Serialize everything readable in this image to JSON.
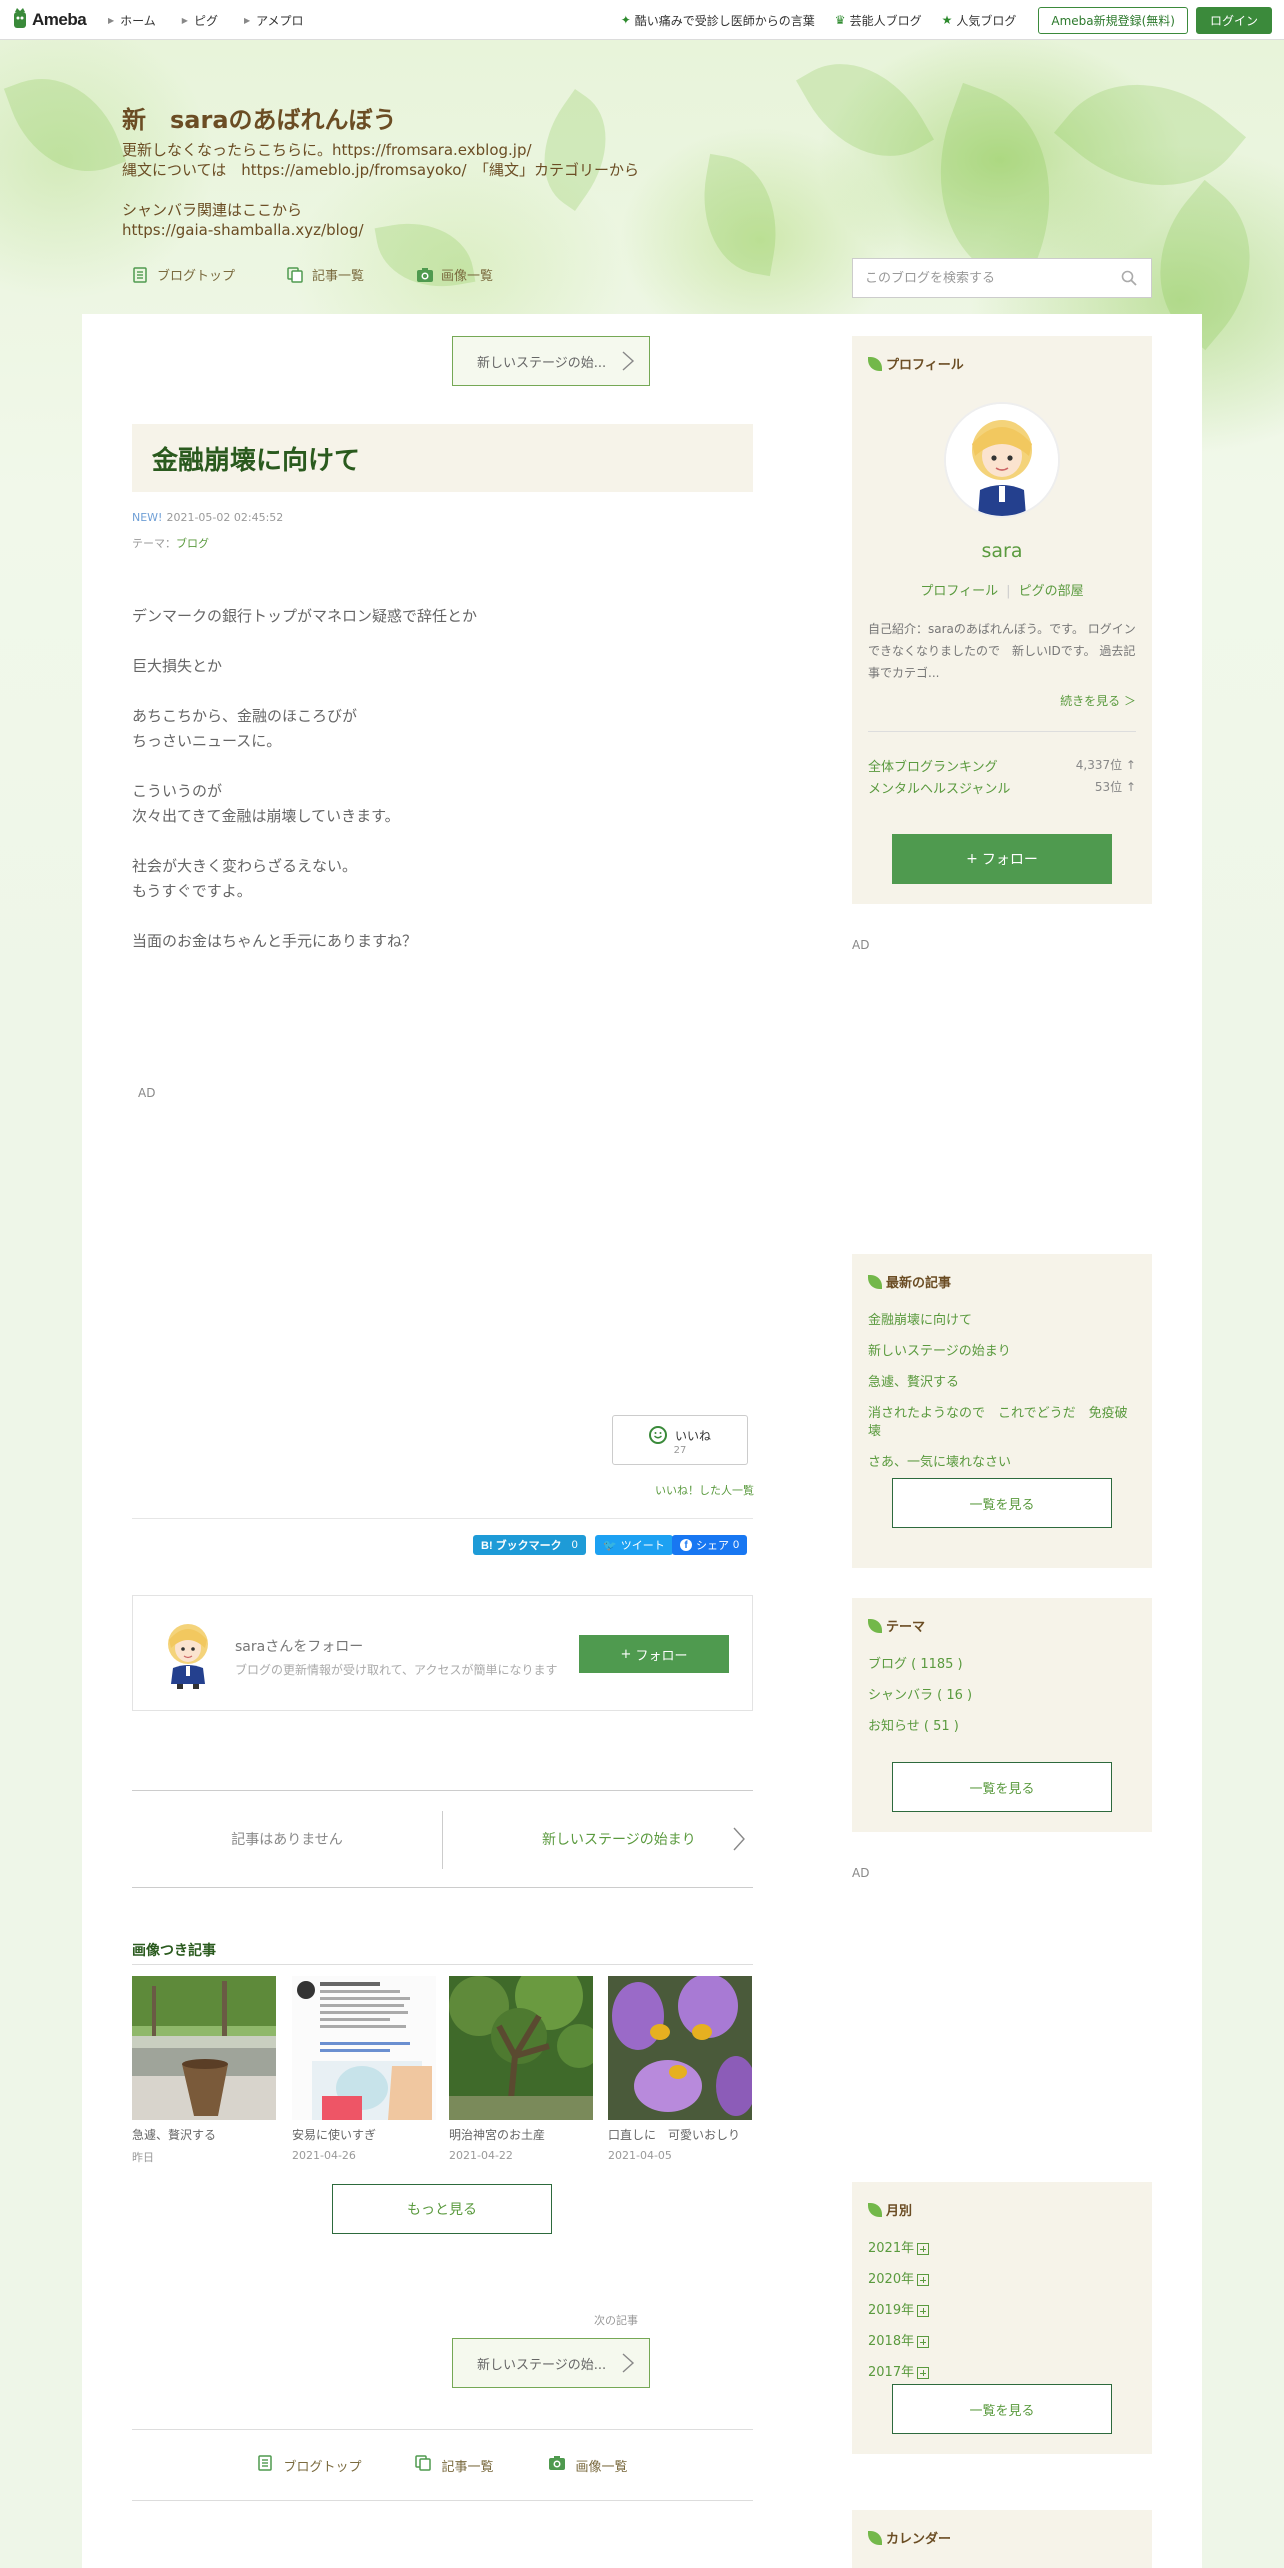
{
  "global_header": {
    "logo_text": "Ameba",
    "nav_left": [
      "ホーム",
      "ピグ",
      "アメプロ"
    ],
    "nav_right": [
      {
        "label": "酷い痛みで受診し医師からの言葉",
        "icon": "sparkle-icon"
      },
      {
        "label": "芸能人ブログ",
        "icon": "crown-icon"
      },
      {
        "label": "人気ブログ",
        "icon": "star-icon"
      }
    ],
    "register_label": "Ameba新規登録(無料)",
    "login_label": "ログイン"
  },
  "blog": {
    "title": "新　saraのあばれんぼう",
    "description": "更新しなくなったらこちらに。https://fromsara.exblog.jp/\n縄文については　https://ameblo.jp/fromsayoko/　「縄文」カテゴリーから\n\nシャンバラ関連はここから\nhttps://gaia-shamballa.xyz/blog/",
    "nav": {
      "top": "ブログトップ",
      "list": "記事一覧",
      "images": "画像一覧"
    },
    "search_placeholder": "このブログを検索する"
  },
  "article": {
    "prev_stage_label": "新しいステージの始...",
    "title": "金融崩壊に向けて",
    "new_badge": "NEW!",
    "datetime": "2021-05-02 02:45:52",
    "theme_prefix": "テーマ：",
    "theme": "ブログ",
    "paragraphs": [
      "デンマークの銀行トップがマネロン疑惑で辞任とか",
      "巨大損失とか",
      "あちこちから、金融のほころびが\nちっさいニュースに。",
      "こういうのが\n次々出てきて金融は崩壊していきます。",
      "社会が大きく変わらざるえない。\nもうすぐですよ。",
      "当面のお金はちゃんと手元にありますね？"
    ],
    "ad_label": "AD",
    "iine_label": "いいね",
    "iine_count": "27",
    "iine_list_label": "いいね！した人一覧",
    "share": {
      "hatena": {
        "label": "B! ブックマーク",
        "count": "0"
      },
      "tweet": {
        "label": "ツイート"
      },
      "facebook": {
        "label": "シェア",
        "count": "0"
      }
    },
    "follow_card": {
      "name": "saraさんをフォロー",
      "sub": "ブログの更新情報が受け取れて、アクセスが簡単になります",
      "button": "フォロー"
    },
    "pager": {
      "prev": "記事はありません",
      "next": "新しいステージの始まり"
    },
    "image_articles": {
      "title": "画像つき記事",
      "items": [
        {
          "caption": "急遽、贅沢する",
          "date": "昨日"
        },
        {
          "caption": "安易に使いすぎ",
          "date": "2021-04-26"
        },
        {
          "caption": "明治神宮のお土産",
          "date": "2021-04-22"
        },
        {
          "caption": "口直しに　可愛いおしり",
          "date": "2021-04-05"
        }
      ],
      "more_label": "もっと見る"
    },
    "next_article_label": "次の記事",
    "next_stage_label": "新しいステージの始..."
  },
  "sidebar": {
    "profile": {
      "heading": "プロフィール",
      "name": "sara",
      "link_profile": "プロフィール",
      "link_room": "ピグの部屋",
      "description": "自己紹介：saraのあばれんぼう。です。 ログインできなくなりましたので　新しいIDです。 過去記事でカテゴ...",
      "more": "続きを見る ＞",
      "ranking": [
        {
          "label": "全体ブログランキング",
          "value": "4,337位 ↑"
        },
        {
          "label": "メンタルヘルスジャンル",
          "value": "53位 ↑"
        }
      ],
      "follow": "フォロー"
    },
    "ad_label": "AD",
    "recent": {
      "heading": "最新の記事",
      "items": [
        "金融崩壊に向けて",
        "新しいステージの始まり",
        "急遽、贅沢する",
        "消されたようなので　これでどうだ　免疫破壊",
        "さあ、一気に壊れなさい"
      ],
      "button": "一覧を見る"
    },
    "themes": {
      "heading": "テーマ",
      "items": [
        "ブログ ( 1185 )",
        "シャンバラ ( 16 )",
        "お知らせ ( 51 )"
      ],
      "button": "一覧を見る"
    },
    "monthly": {
      "heading": "月別",
      "items": [
        "2021年",
        "2020年",
        "2019年",
        "2018年",
        "2017年"
      ],
      "button": "一覧を見る"
    },
    "calendar": {
      "heading": "カレンダー"
    }
  }
}
